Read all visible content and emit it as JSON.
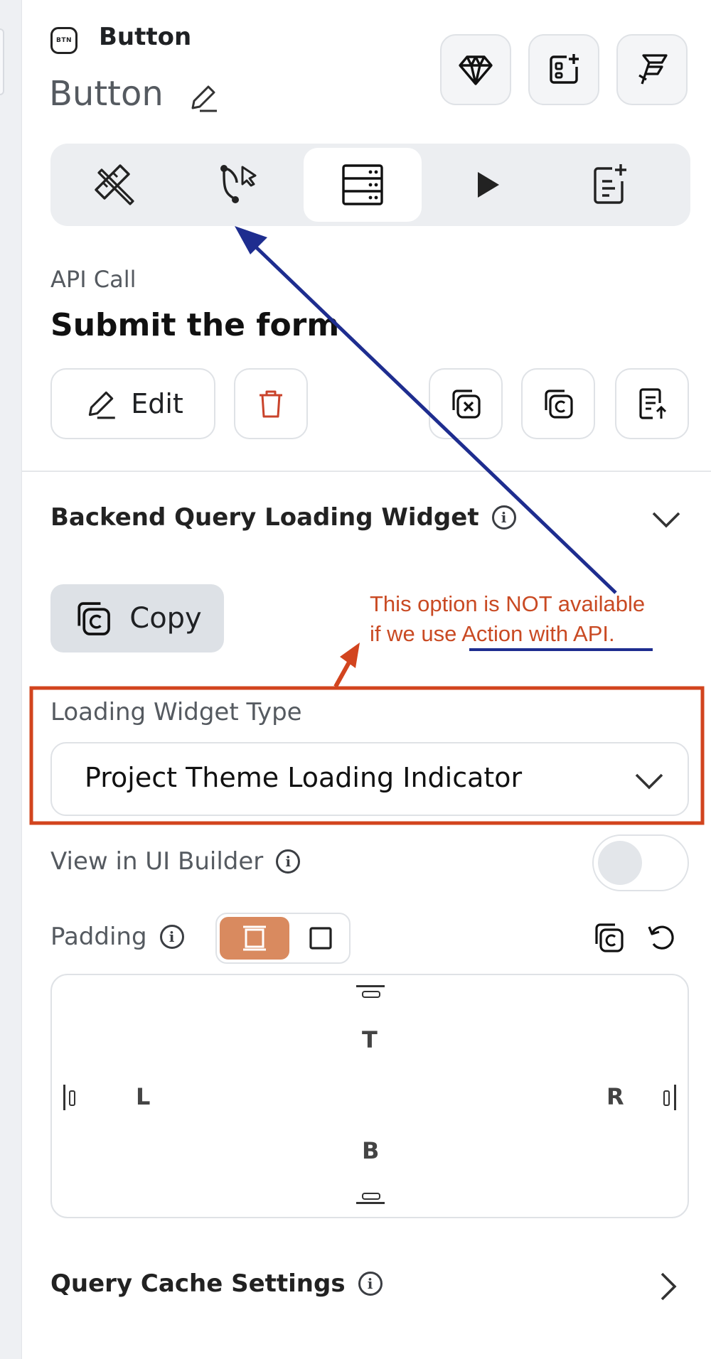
{
  "widget": {
    "badge": "BTN",
    "type_label": "Button",
    "name": "Button"
  },
  "action": {
    "section_label": "API Call",
    "title": "Submit the form",
    "edit_label": "Edit"
  },
  "loading_section": {
    "title": "Backend Query Loading Widget",
    "copy_label": "Copy",
    "type_label": "Loading Widget Type",
    "type_value": "Project Theme Loading Indicator"
  },
  "ui_builder": {
    "label": "View in UI Builder"
  },
  "padding": {
    "label": "Padding",
    "top": "T",
    "left": "L",
    "right": "R",
    "bottom": "B"
  },
  "cache": {
    "label": "Query Cache Settings"
  },
  "annotation": {
    "line1": "This option is NOT available",
    "line2": "if we use Action with API.",
    "text_color": "#c94a23",
    "box_color": "#d2441e",
    "arrow_color": "#1e2d8f"
  },
  "colors": {
    "accent": "#d98a5f",
    "toggle_off": "#e3e6ea"
  }
}
